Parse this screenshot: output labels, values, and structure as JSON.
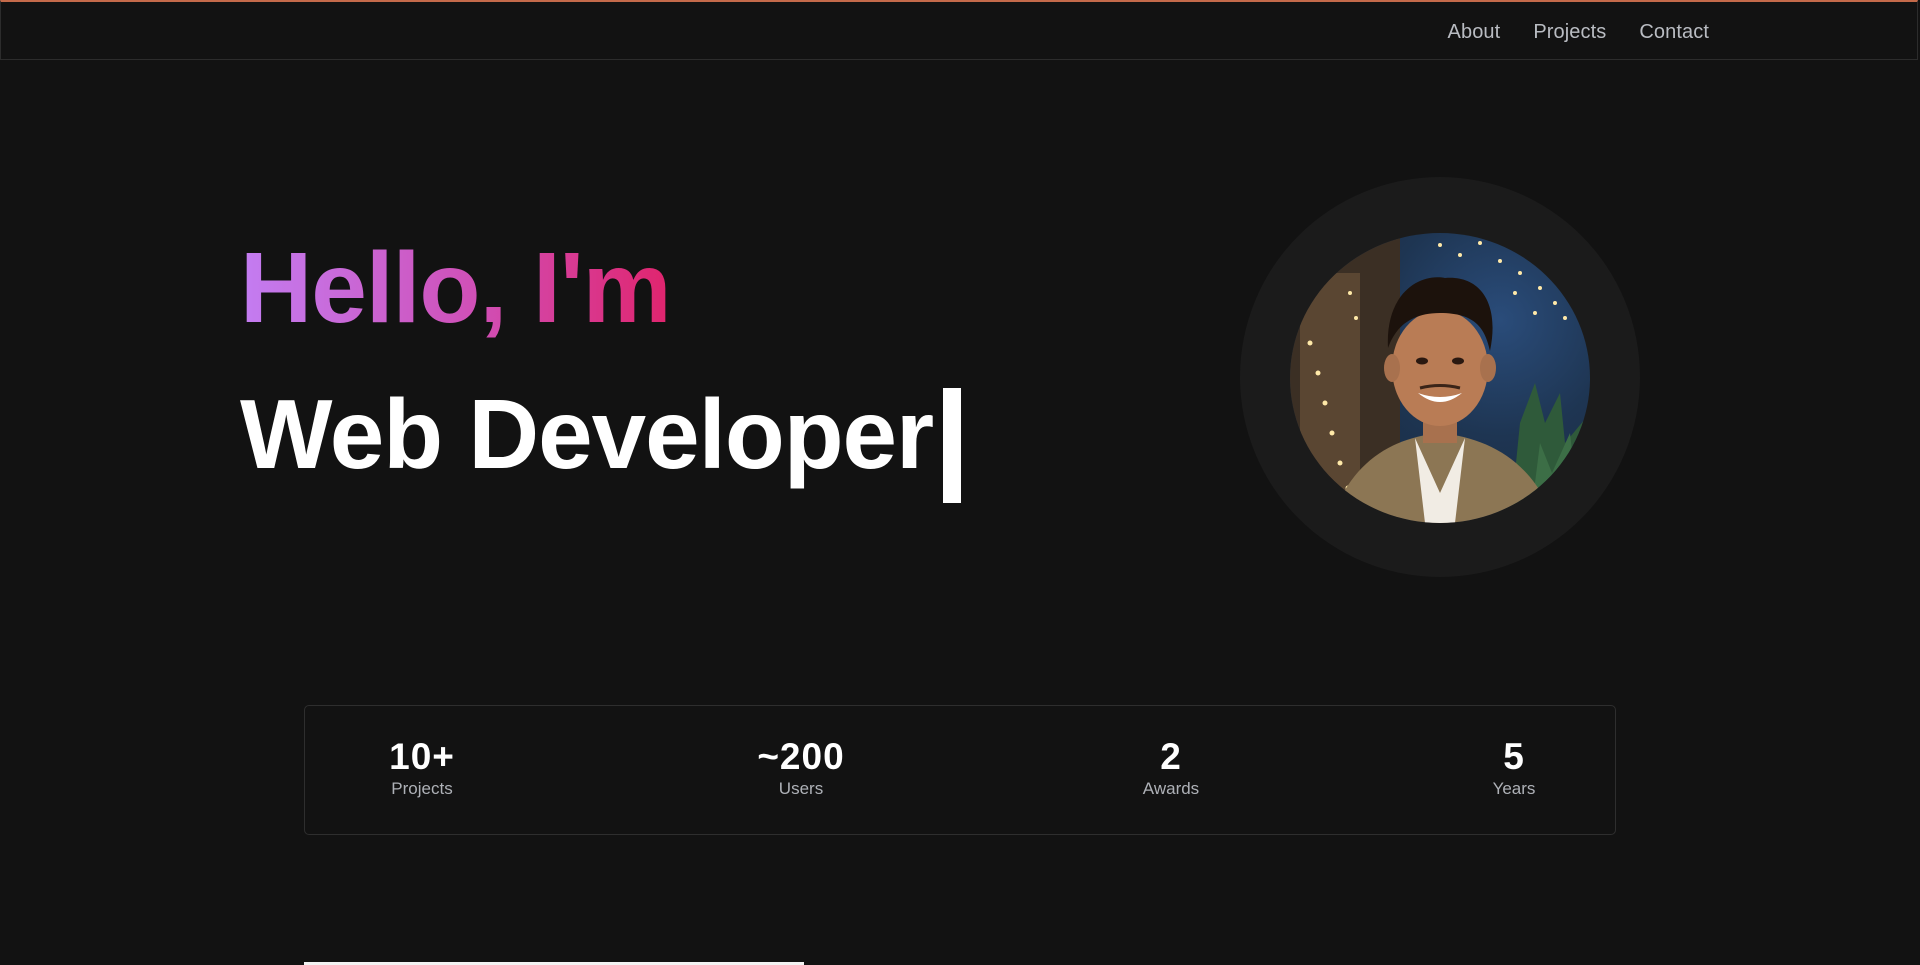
{
  "nav": {
    "items": [
      {
        "label": "About"
      },
      {
        "label": "Projects"
      },
      {
        "label": "Contact"
      }
    ]
  },
  "hero": {
    "greeting": "Hello, I'm",
    "role": "Web Developer"
  },
  "stats": [
    {
      "value": "10+",
      "label": "Projects"
    },
    {
      "value": "~200",
      "label": "Users"
    },
    {
      "value": "2",
      "label": "Awards"
    },
    {
      "value": "5",
      "label": "Years"
    }
  ],
  "colors": {
    "background": "#121212",
    "accent_top_border": "#c46a4a",
    "gradient_start": "#c37df2",
    "gradient_end": "#e0246d"
  }
}
